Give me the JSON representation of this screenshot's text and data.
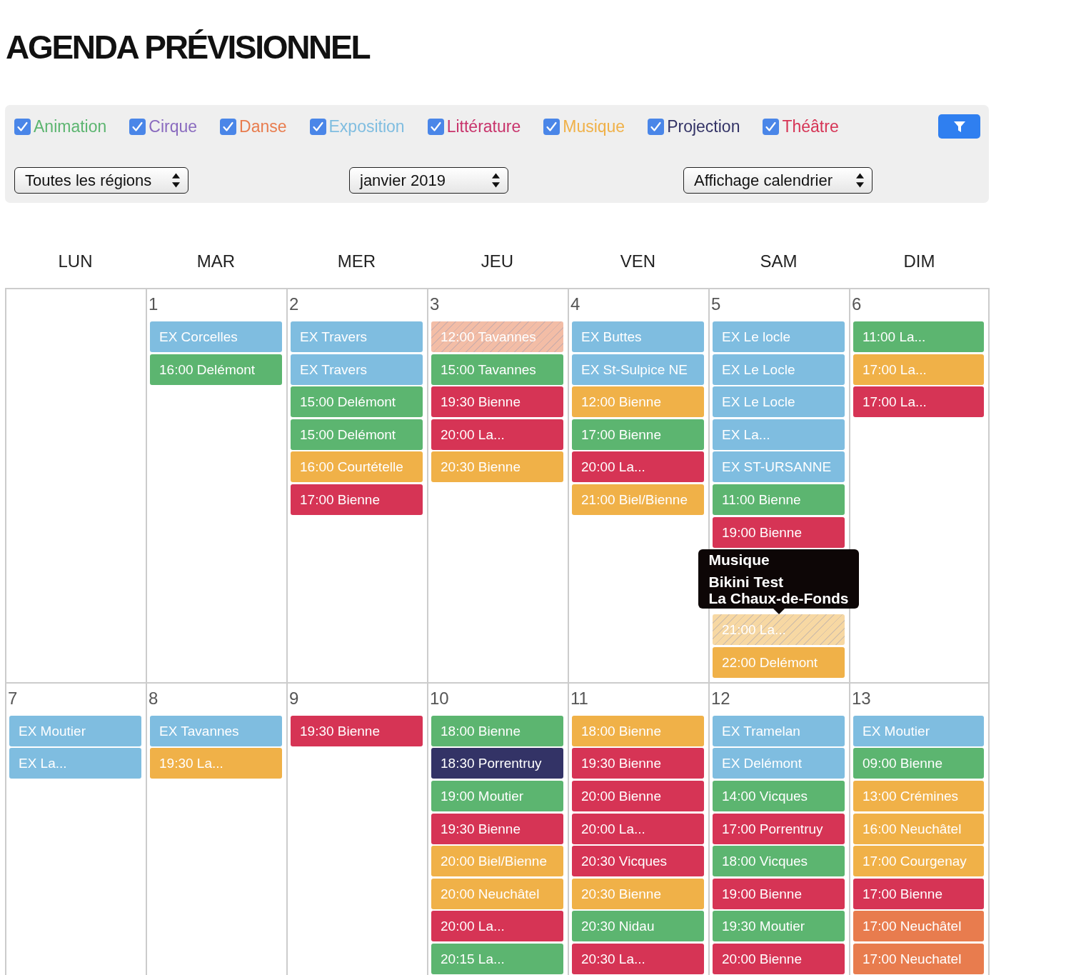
{
  "page": {
    "title": "AGENDA PRÉVISIONNEL"
  },
  "filters": {
    "categories": [
      {
        "label": "Animation",
        "color": "#5cb570",
        "checked": true
      },
      {
        "label": "Cirque",
        "color": "#8a6bbf",
        "checked": true
      },
      {
        "label": "Danse",
        "color": "#e87c4e",
        "checked": true
      },
      {
        "label": "Exposition",
        "color": "#7fbde0",
        "checked": true
      },
      {
        "label": "Littérature",
        "color": "#c8336b",
        "checked": true
      },
      {
        "label": "Musique",
        "color": "#f0b148",
        "checked": true
      },
      {
        "label": "Projection",
        "color": "#333366",
        "checked": true
      },
      {
        "label": "Théâtre",
        "color": "#d63455",
        "checked": true
      }
    ],
    "selects": [
      {
        "kind": "region",
        "value": "Toutes les régions"
      },
      {
        "kind": "month",
        "value": "janvier 2019"
      },
      {
        "kind": "view",
        "value": "Affichage calendrier"
      }
    ]
  },
  "calendar": {
    "weekdays": [
      "LUN",
      "MAR",
      "MER",
      "JEU",
      "VEN",
      "SAM",
      "DIM"
    ],
    "weeks": [
      {
        "days": [
          {
            "number": "1",
            "events": [
              {
                "label": "EX Corcelles",
                "color": "#7fbde0",
                "hatched": false
              },
              {
                "label": "16:00 Delémont",
                "color": "#5cb570",
                "hatched": false
              }
            ]
          },
          {
            "number": "2",
            "events": [
              {
                "label": "EX Travers",
                "color": "#7fbde0",
                "hatched": false
              },
              {
                "label": "EX Travers",
                "color": "#7fbde0",
                "hatched": false
              },
              {
                "label": "15:00 Delémont",
                "color": "#5cb570",
                "hatched": false
              },
              {
                "label": "15:00 Delémont",
                "color": "#5cb570",
                "hatched": false
              },
              {
                "label": "16:00 Courtételle",
                "color": "#f0b148",
                "hatched": false
              },
              {
                "label": "17:00 Bienne",
                "color": "#d63455",
                "hatched": false
              }
            ]
          },
          {
            "number": "3",
            "events": [
              {
                "label": "12:00 Tavannes",
                "color": "#f3bda6",
                "hatched": true
              },
              {
                "label": "15:00 Tavannes",
                "color": "#5cb570",
                "hatched": false
              },
              {
                "label": "19:30 Bienne",
                "color": "#d63455",
                "hatched": false
              },
              {
                "label": "20:00 La...",
                "color": "#d63455",
                "hatched": false
              },
              {
                "label": "20:30 Bienne",
                "color": "#f0b148",
                "hatched": false
              }
            ]
          },
          {
            "number": "4",
            "events": [
              {
                "label": "EX Buttes",
                "color": "#7fbde0",
                "hatched": false
              },
              {
                "label": "EX St-Sulpice NE",
                "color": "#7fbde0",
                "hatched": false
              },
              {
                "label": "12:00 Bienne",
                "color": "#f0b148",
                "hatched": false
              },
              {
                "label": "17:00 Bienne",
                "color": "#5cb570",
                "hatched": false
              },
              {
                "label": "20:00 La...",
                "color": "#d63455",
                "hatched": false
              },
              {
                "label": "21:00 Biel/Bienne",
                "color": "#f0b148",
                "hatched": false
              }
            ]
          },
          {
            "number": "5",
            "events": [
              {
                "label": "EX Le locle",
                "color": "#7fbde0",
                "hatched": false
              },
              {
                "label": "EX Le Locle",
                "color": "#7fbde0",
                "hatched": false
              },
              {
                "label": "EX Le Locle",
                "color": "#7fbde0",
                "hatched": false
              },
              {
                "label": "EX La...",
                "color": "#7fbde0",
                "hatched": false
              },
              {
                "label": "EX ST-URSANNE",
                "color": "#7fbde0",
                "hatched": false
              },
              {
                "label": "11:00 Bienne",
                "color": "#5cb570",
                "hatched": false
              },
              {
                "label": "19:00 Bienne",
                "color": "#d63455",
                "hatched": false
              },
              {
                "label": "21:00 La...",
                "color": "#f7d8a3",
                "hatched": true,
                "tooltip": {
                  "heading": "Musique",
                  "title": "Bikini Test",
                  "place": "La Chaux-de-Fonds"
                }
              },
              {
                "label": "22:00 Delémont",
                "color": "#f0b148",
                "hatched": false
              }
            ]
          },
          {
            "number": "6",
            "events": [
              {
                "label": "11:00 La...",
                "color": "#5cb570",
                "hatched": false
              },
              {
                "label": "17:00 La...",
                "color": "#f0b148",
                "hatched": false
              },
              {
                "label": "17:00 La...",
                "color": "#d63455",
                "hatched": false
              }
            ]
          }
        ]
      },
      {
        "days": [
          {
            "number": "7",
            "events": [
              {
                "label": "EX Moutier",
                "color": "#7fbde0",
                "hatched": false
              },
              {
                "label": "EX La...",
                "color": "#7fbde0",
                "hatched": false
              }
            ]
          },
          {
            "number": "8",
            "events": [
              {
                "label": "EX Tavannes",
                "color": "#7fbde0",
                "hatched": false
              },
              {
                "label": "19:30 La...",
                "color": "#f0b148",
                "hatched": false
              }
            ]
          },
          {
            "number": "9",
            "events": [
              {
                "label": "19:30 Bienne",
                "color": "#d63455",
                "hatched": false
              }
            ]
          },
          {
            "number": "10",
            "events": [
              {
                "label": "18:00 Bienne",
                "color": "#5cb570",
                "hatched": false
              },
              {
                "label": "18:30 Porrentruy",
                "color": "#333366",
                "hatched": false
              },
              {
                "label": "19:00 Moutier",
                "color": "#5cb570",
                "hatched": false
              },
              {
                "label": "19:30 Bienne",
                "color": "#d63455",
                "hatched": false
              },
              {
                "label": "20:00 Biel/Bienne",
                "color": "#f0b148",
                "hatched": false
              },
              {
                "label": "20:00 Neuchâtel",
                "color": "#f0b148",
                "hatched": false
              },
              {
                "label": "20:00 La...",
                "color": "#d63455",
                "hatched": false
              },
              {
                "label": "20:15 La...",
                "color": "#5cb570",
                "hatched": false
              }
            ]
          },
          {
            "number": "11",
            "events": [
              {
                "label": "18:00 Bienne",
                "color": "#f0b148",
                "hatched": false
              },
              {
                "label": "19:30 Bienne",
                "color": "#d63455",
                "hatched": false
              },
              {
                "label": "20:00 Bienne",
                "color": "#d63455",
                "hatched": false
              },
              {
                "label": "20:00 La...",
                "color": "#d63455",
                "hatched": false
              },
              {
                "label": "20:30 Vicques",
                "color": "#d63455",
                "hatched": false
              },
              {
                "label": "20:30 Bienne",
                "color": "#f0b148",
                "hatched": false
              },
              {
                "label": "20:30 Nidau",
                "color": "#5cb570",
                "hatched": false
              },
              {
                "label": "20:30 La...",
                "color": "#d63455",
                "hatched": false
              }
            ]
          },
          {
            "number": "12",
            "events": [
              {
                "label": "EX Tramelan",
                "color": "#7fbde0",
                "hatched": false
              },
              {
                "label": "EX Delémont",
                "color": "#7fbde0",
                "hatched": false
              },
              {
                "label": "14:00 Vicques",
                "color": "#5cb570",
                "hatched": false
              },
              {
                "label": "17:00 Porrentruy",
                "color": "#d63455",
                "hatched": false
              },
              {
                "label": "18:00 Vicques",
                "color": "#5cb570",
                "hatched": false
              },
              {
                "label": "19:00 Bienne",
                "color": "#d63455",
                "hatched": false
              },
              {
                "label": "19:30 Moutier",
                "color": "#5cb570",
                "hatched": false
              },
              {
                "label": "20:00 Bienne",
                "color": "#d63455",
                "hatched": false
              }
            ]
          },
          {
            "number": "13",
            "events": [
              {
                "label": "EX Moutier",
                "color": "#7fbde0",
                "hatched": false
              },
              {
                "label": "09:00 Bienne",
                "color": "#5cb570",
                "hatched": false
              },
              {
                "label": "13:00 Crémines",
                "color": "#f0b148",
                "hatched": false
              },
              {
                "label": "16:00 Neuchâtel",
                "color": "#f0b148",
                "hatched": false
              },
              {
                "label": "17:00 Courgenay",
                "color": "#f0b148",
                "hatched": false
              },
              {
                "label": "17:00 Bienne",
                "color": "#d63455",
                "hatched": false
              },
              {
                "label": "17:00 Neuchâtel",
                "color": "#e87c4e",
                "hatched": false
              },
              {
                "label": "17:00 Neuchatel",
                "color": "#e87c4e",
                "hatched": false
              }
            ]
          }
        ]
      }
    ]
  }
}
